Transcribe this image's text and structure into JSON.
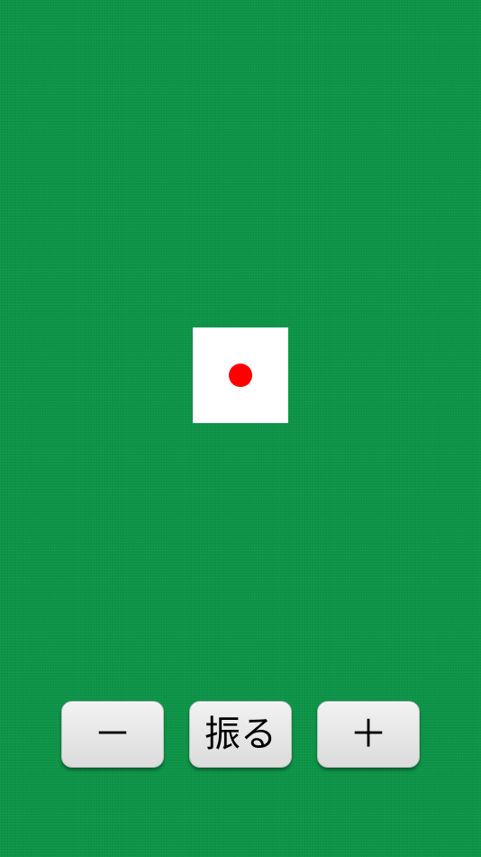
{
  "app": {
    "background_color": "#0a9447"
  },
  "die": {
    "face_value": 1,
    "face_color": "#ffffff",
    "pip_color": "#ff0000"
  },
  "controls": {
    "minus_label": "－",
    "roll_label": "振る",
    "plus_label": "＋"
  }
}
